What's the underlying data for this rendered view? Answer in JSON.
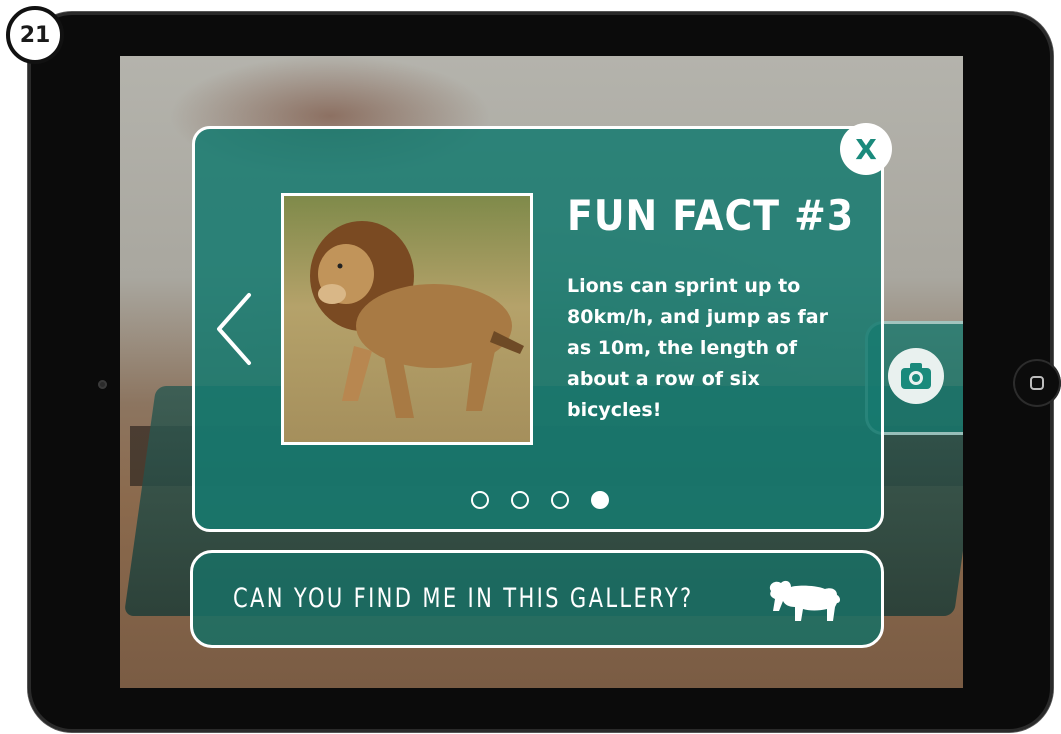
{
  "page_number": "21",
  "fact_card": {
    "title": "FUN FACT #3",
    "body": "Lions can sprint up to 80km/h, and jump as far as 10m, the length of about a row of six bicycles!",
    "close_label": "X",
    "pager": {
      "total": 4,
      "active_index": 3
    }
  },
  "find_bar": {
    "label": "CAN YOU FIND ME IN THIS GALLERY?"
  },
  "icons": {
    "prev": "chevron-left-icon",
    "camera": "camera-icon",
    "lion": "lion-silhouette-icon"
  },
  "colors": {
    "card_teal": "#167a70",
    "close_x": "#1a8a7c",
    "border": "#ffffff"
  }
}
